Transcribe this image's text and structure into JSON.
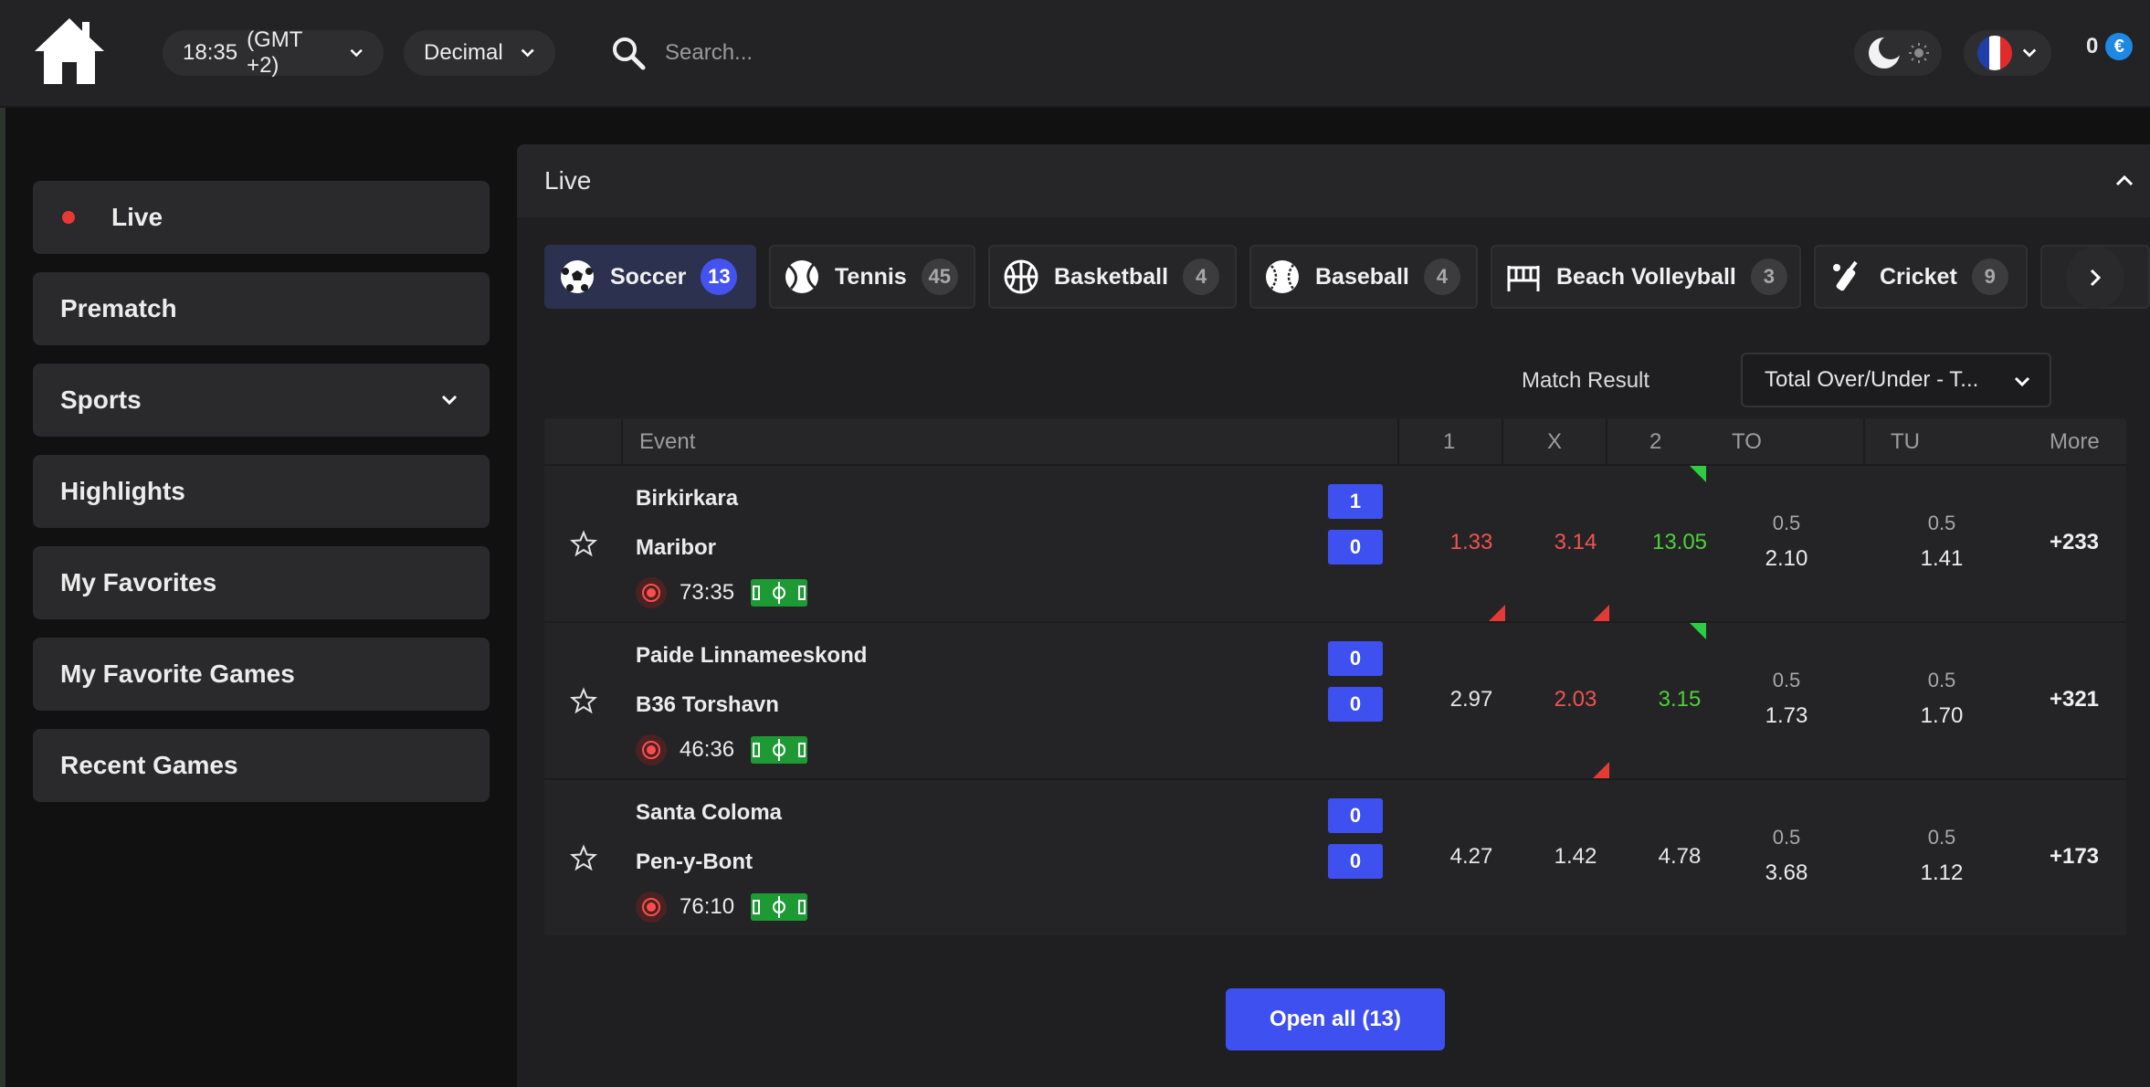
{
  "header": {
    "time": "18:35",
    "timezone": "(GMT +2)",
    "odds_format": "Decimal",
    "search_placeholder": "Search...",
    "balance": "0",
    "currency_symbol": "€",
    "language": "France"
  },
  "sidebar": {
    "items": [
      {
        "label": "Live"
      },
      {
        "label": "Prematch"
      },
      {
        "label": "Sports"
      },
      {
        "label": "Highlights"
      },
      {
        "label": "My Favorites"
      },
      {
        "label": "My Favorite Games"
      },
      {
        "label": "Recent Games"
      }
    ]
  },
  "main": {
    "title": "Live",
    "sports": [
      {
        "label": "Soccer",
        "count": "13",
        "active": true
      },
      {
        "label": "Tennis",
        "count": "45"
      },
      {
        "label": "Basketball",
        "count": "4"
      },
      {
        "label": "Baseball",
        "count": "4"
      },
      {
        "label": "Beach Volleyball",
        "count": "3"
      },
      {
        "label": "Cricket",
        "count": "9"
      }
    ],
    "match_result_label": "Match Result",
    "market_select": "Total Over/Under - T...",
    "columns": {
      "event": "Event",
      "c1": "1",
      "cx": "X",
      "c2": "2",
      "to": "TO",
      "tu": "TU",
      "more": "More"
    },
    "events": [
      {
        "team1": "Birkirkara",
        "team2": "Maribor",
        "score1": "1",
        "score2": "0",
        "time": "73:35",
        "odd1": "1.33",
        "oddx": "3.14",
        "odd2": "13.05",
        "to_line": "0.5",
        "to_val": "2.10",
        "tu_line": "0.5",
        "tu_val": "1.41",
        "more": "+233"
      },
      {
        "team1": "Paide Linnameeskond",
        "team2": "B36 Torshavn",
        "score1": "0",
        "score2": "0",
        "time": "46:36",
        "odd1": "2.97",
        "oddx": "2.03",
        "odd2": "3.15",
        "to_line": "0.5",
        "to_val": "1.73",
        "tu_line": "0.5",
        "tu_val": "1.70",
        "more": "+321"
      },
      {
        "team1": "Santa Coloma",
        "team2": "Pen-y-Bont",
        "score1": "0",
        "score2": "0",
        "time": "76:10",
        "odd1": "4.27",
        "oddx": "1.42",
        "odd2": "4.78",
        "to_line": "0.5",
        "to_val": "3.68",
        "tu_line": "0.5",
        "tu_val": "1.12",
        "more": "+173"
      }
    ],
    "open_all": "Open all (13)"
  },
  "colors": {
    "accent": "#3f50f0",
    "odds_up": "#4cd137",
    "odds_down": "#ef5350",
    "live_dot": "#e53935"
  }
}
